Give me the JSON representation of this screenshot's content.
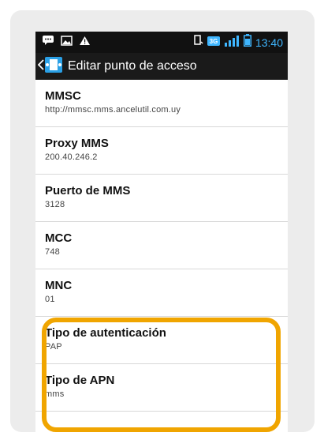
{
  "status_bar": {
    "time": "13:40",
    "network_badge": "3G",
    "left_icons": [
      "chat-notification-icon",
      "image-notification-icon",
      "warning-icon"
    ],
    "right_icons": [
      "vibrate-icon",
      "network-3g-icon",
      "signal-icon",
      "battery-icon"
    ]
  },
  "action_bar": {
    "title": "Editar punto de acceso",
    "icon": "settings-app-icon"
  },
  "items": [
    {
      "title": "MMSC",
      "value": "http://mmsc.mms.ancelutil.com.uy"
    },
    {
      "title": "Proxy MMS",
      "value": "200.40.246.2"
    },
    {
      "title": "Puerto de MMS",
      "value": "3128"
    },
    {
      "title": "MCC",
      "value": "748"
    },
    {
      "title": "MNC",
      "value": "01"
    },
    {
      "title": "Tipo de autenticación",
      "value": "PAP"
    },
    {
      "title": "Tipo de APN",
      "value": "mms"
    }
  ],
  "colors": {
    "highlight": "#f0a500",
    "clock": "#3fb6ff",
    "background_card": "#ececec"
  }
}
